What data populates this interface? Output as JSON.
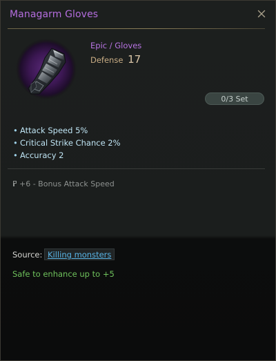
{
  "tooltip": {
    "title": "Managarm Gloves",
    "rarity_type": "Epic / Gloves",
    "defense_label": "Defense",
    "defense_value": "17",
    "set_badge": "0/3 Set",
    "stats": [
      "Attack Speed 5%",
      "Critical Strike Chance 2%",
      "Accuracy 2"
    ],
    "bonus": "+6 - Bonus Attack Speed",
    "source_label": "Source:",
    "source_value": "Killing monsters",
    "enhance_note": "Safe to enhance up to +5"
  },
  "icons": {
    "close": "close-icon",
    "item": "gloves-icon",
    "bullet": "bullet-icon",
    "bonus": "enhance-bonus-icon"
  },
  "colors": {
    "title": "#b46dde",
    "rarity_epic": "#b874e3",
    "stat_text": "#bfe4f4",
    "link": "#59b4e6",
    "enhance_safe": "#6fc25c",
    "panel_bg": "#1c1f1e"
  }
}
